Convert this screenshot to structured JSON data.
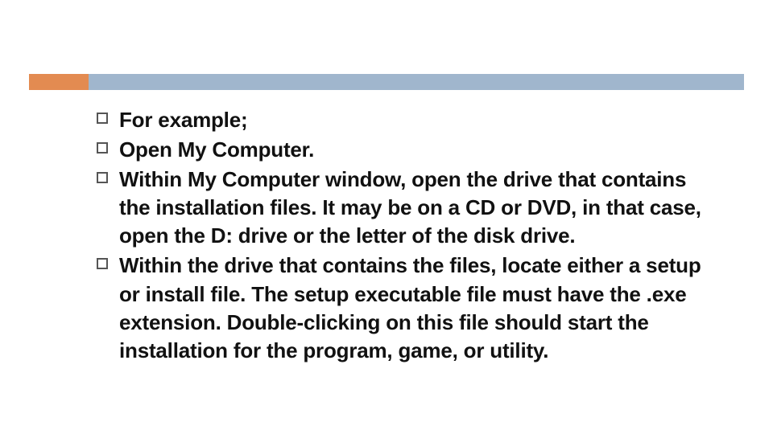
{
  "bullets": [
    {
      "text": "For example;"
    },
    {
      "text": "Open My Computer."
    },
    {
      "text": "Within My Computer window, open the drive that contains the installation files. It  may be on a CD or DVD, in that case, open the D: drive or the letter of the disk drive."
    },
    {
      "text": "Within the drive that contains the files, locate either a setup or install file. The setup executable file must have the .exe extension. Double-clicking on this file should start the installation for the program, game, or utility."
    }
  ],
  "colors": {
    "accent": "#e38b51",
    "bar": "#a0b6cd"
  }
}
